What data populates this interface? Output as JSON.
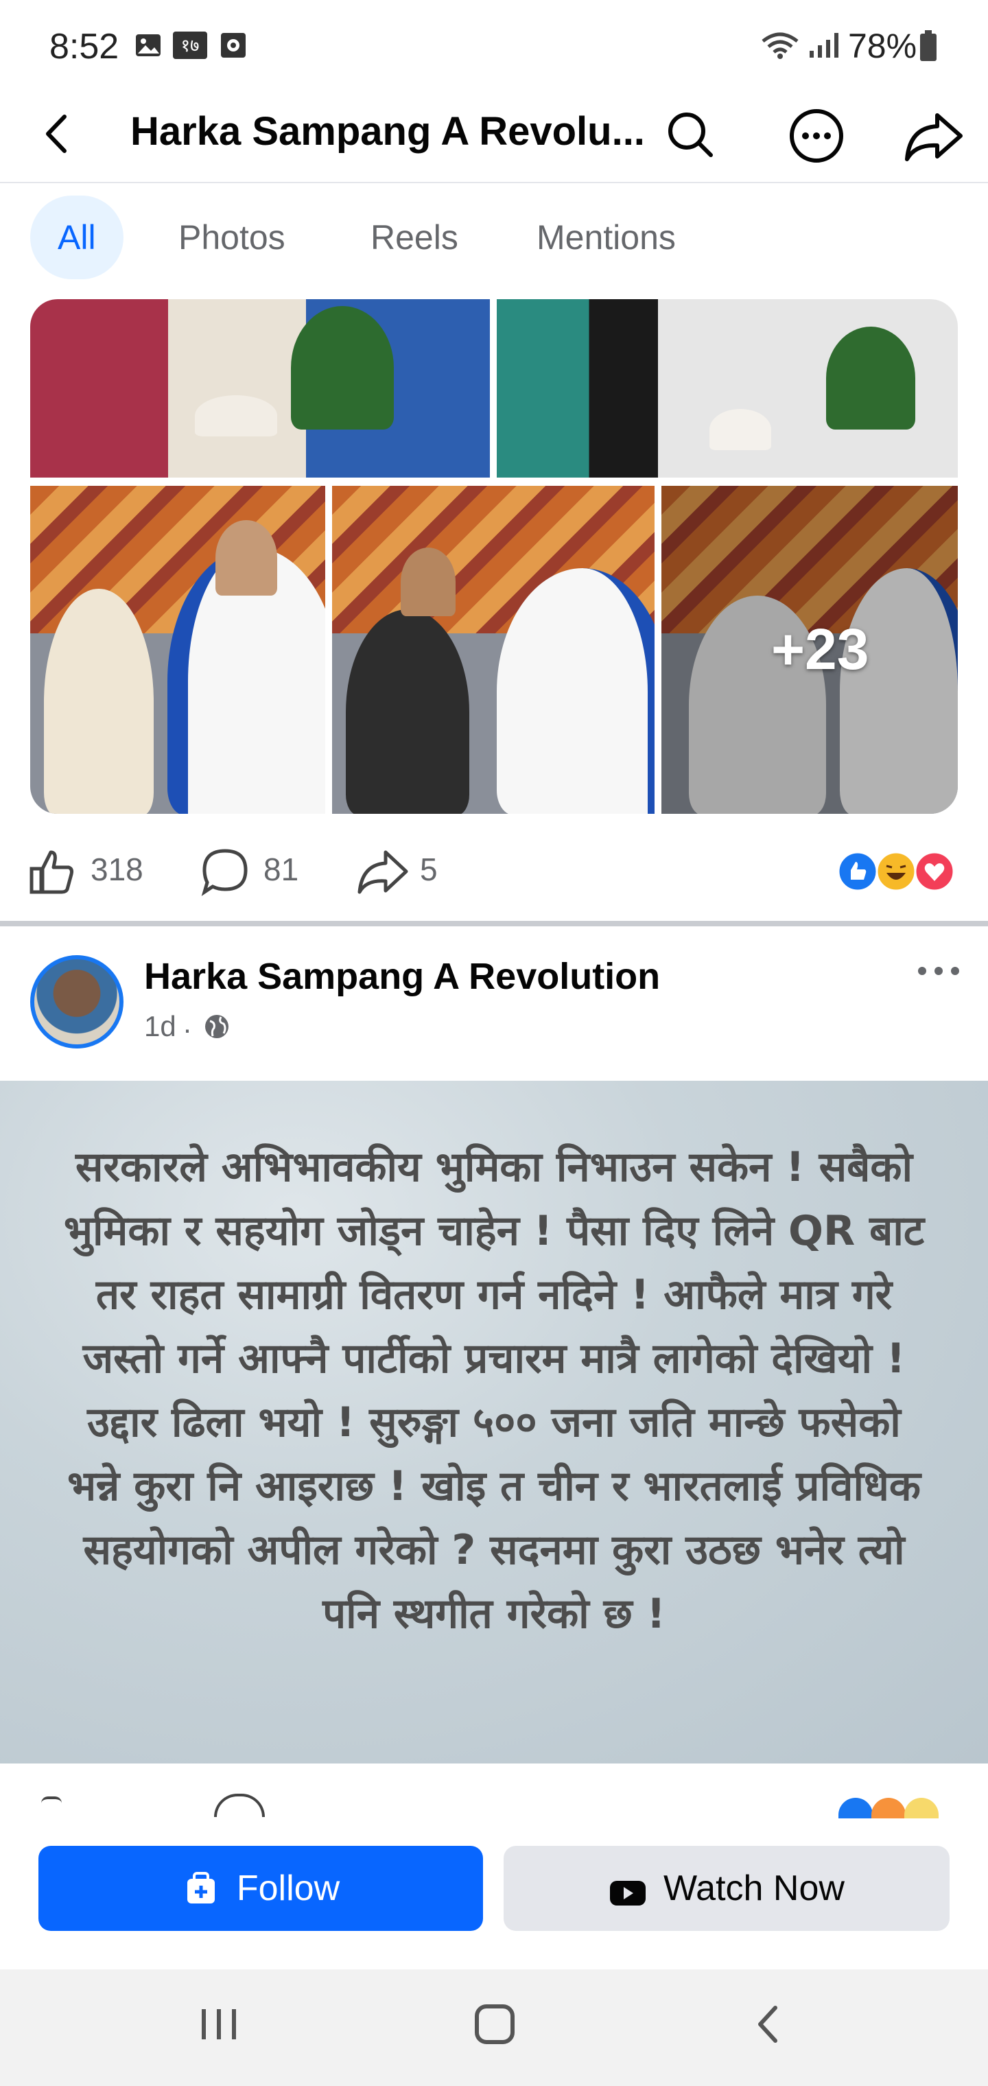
{
  "status_bar": {
    "time": "8:52",
    "notif_text": "१७",
    "battery": "78%"
  },
  "header": {
    "title": "Harka Sampang A Revolu..."
  },
  "tabs": [
    {
      "label": "All",
      "active": true
    },
    {
      "label": "Photos",
      "active": false
    },
    {
      "label": "Reels",
      "active": false
    },
    {
      "label": "Mentions",
      "active": false
    }
  ],
  "post1": {
    "more_photos": "+23",
    "likes": "318",
    "comments": "81",
    "shares": "5",
    "reaction_icons": [
      "like-icon",
      "haha-icon",
      "love-icon"
    ]
  },
  "post2": {
    "page_name": "Harka Sampang A Revolution",
    "time": "1d",
    "privacy_icon": "globe-icon",
    "text": "सरकारले अभिभावकीय भुमिका निभाउन सकेन ! सबैको भुमिका र सहयोग जोड्न चाहेन ! पैसा दिए लिने QR बाट तर राहत सामाग्री वितरण गर्न नदिने ! आफैले मात्र गरे जस्तो गर्ने आफ्नै पार्टीको प्रचारम मात्रै लागेको देखियो ! उद्दार ढिला भयो ! सुरुङ्गा ५०० जना जति मान्छे फसेको भन्ने कुरा नि आइराछ ! खोइ त चीन र भारतलाई प्रविधिक सहयोगको अपील गरेको ? सदनमा कुरा उठछ भनेर त्यो पनि स्थगीत गरेको छ !"
  },
  "buttons": {
    "follow": "Follow",
    "watch": "Watch Now"
  },
  "colors": {
    "brand_blue": "#0866ff",
    "tab_active_bg": "#e7f3ff",
    "secondary_text": "#65676b"
  }
}
